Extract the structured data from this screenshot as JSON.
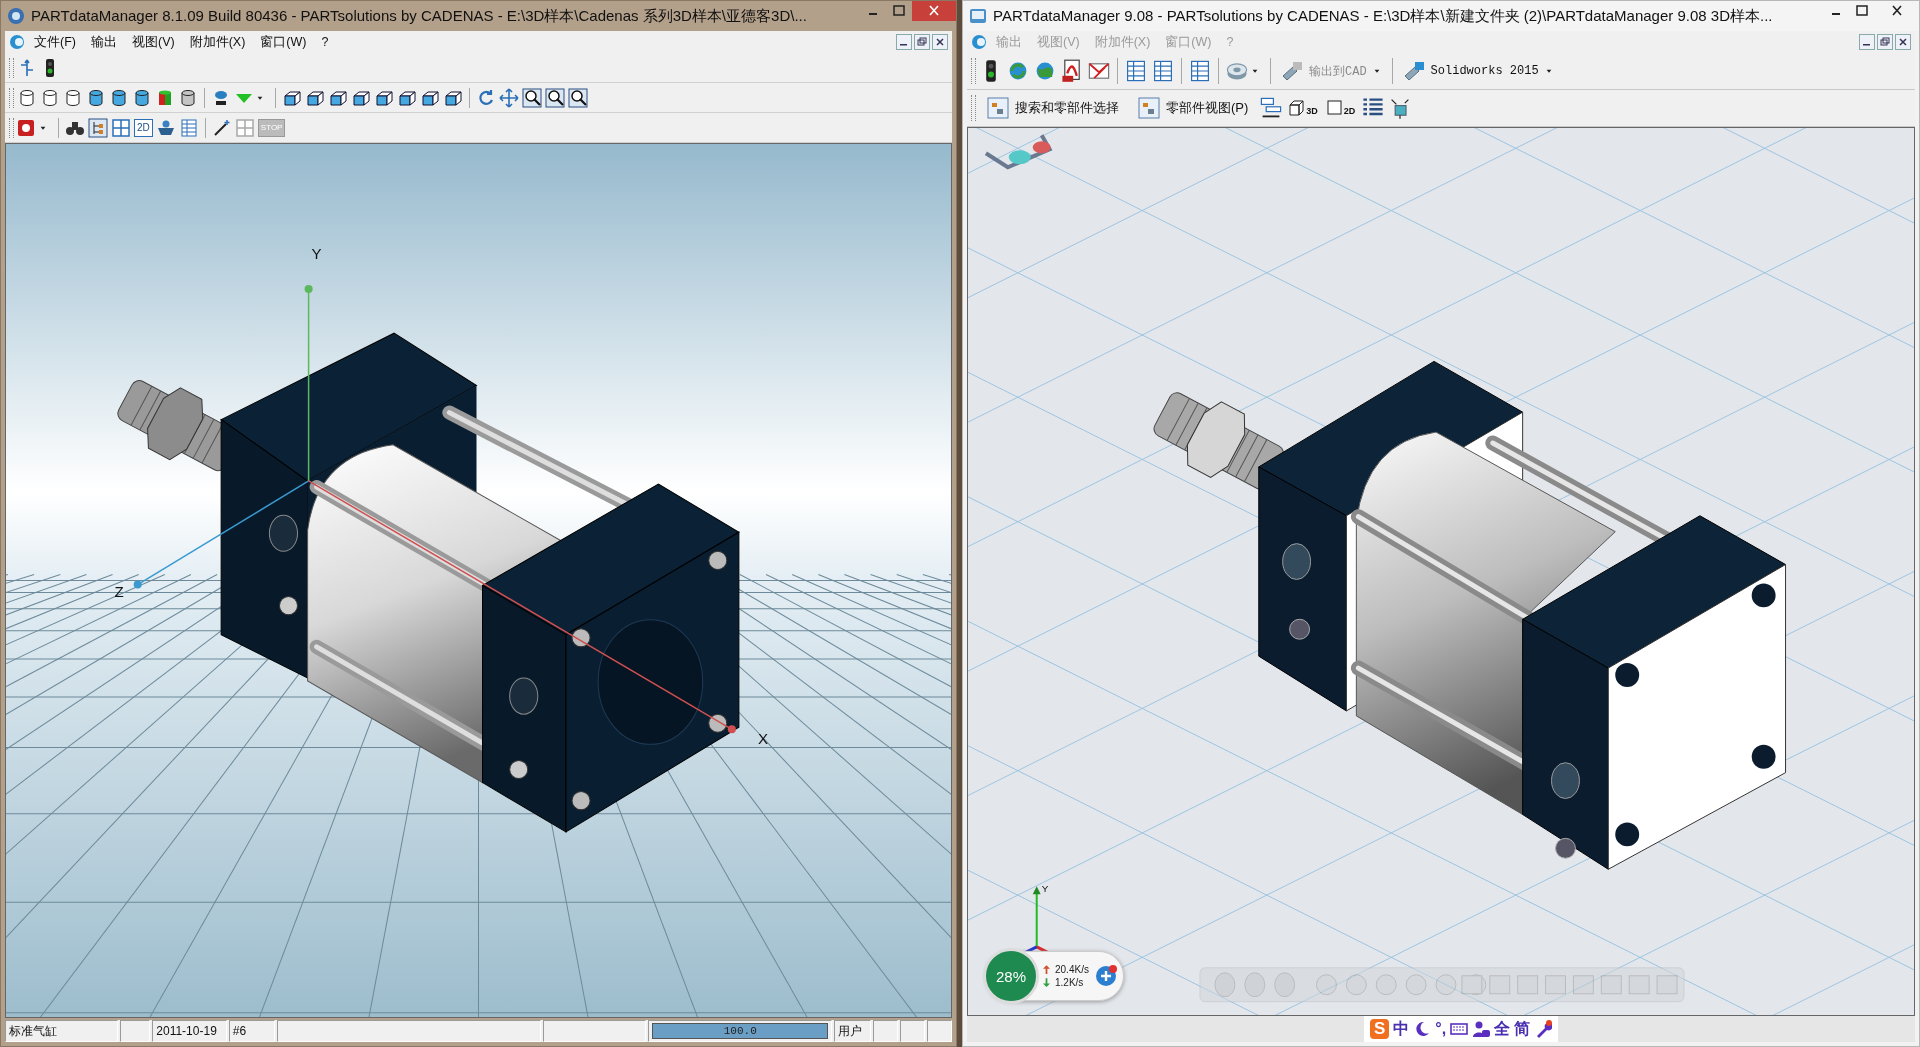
{
  "left_window": {
    "title": "PARTdataManager 8.1.09 Build 80436 - PARTsolutions by CADENAS - E:\\3D样本\\Cadenas 系列3D样本\\亚德客3D\\...",
    "active": true,
    "menu": {
      "disabled": false,
      "items": [
        {
          "label": "文件(F)"
        },
        {
          "label": "输出"
        },
        {
          "label": "视图(V)"
        },
        {
          "label": "附加件(X)"
        },
        {
          "label": "窗口(W)"
        },
        {
          "label": "?"
        }
      ]
    },
    "toolbars": [
      [
        {
          "kind": "arrows"
        },
        {
          "kind": "light"
        }
      ],
      [
        {
          "kind": "cyl-outline"
        },
        {
          "kind": "cyl-outline"
        },
        {
          "kind": "cyl-outline"
        },
        {
          "kind": "cyl-blue"
        },
        {
          "kind": "cyl-blue"
        },
        {
          "kind": "cyl-blue"
        },
        {
          "kind": "cyl-color"
        },
        {
          "kind": "cyl-grey"
        },
        {
          "kind": "lamp"
        },
        {
          "kind": "triangle"
        },
        {
          "kind": "caret"
        },
        {
          "kind": "cube"
        },
        {
          "kind": "cube"
        },
        {
          "kind": "cube"
        },
        {
          "kind": "cube"
        },
        {
          "kind": "cube"
        },
        {
          "kind": "cube"
        },
        {
          "kind": "cube"
        },
        {
          "kind": "cube"
        },
        {
          "kind": "rotate"
        },
        {
          "kind": "move"
        },
        {
          "kind": "zoom"
        },
        {
          "kind": "zoom"
        },
        {
          "kind": "zoom"
        }
      ],
      [
        {
          "kind": "logo"
        },
        {
          "kind": "caret"
        },
        {
          "kind": "binoculars"
        },
        {
          "kind": "tree"
        },
        {
          "kind": "grid"
        },
        {
          "kind": "text",
          "label": "2D"
        },
        {
          "kind": "basket"
        },
        {
          "kind": "table"
        },
        {
          "kind": "wand"
        },
        {
          "kind": "grid-grey"
        },
        {
          "kind": "stop",
          "label": "STOP"
        }
      ]
    ],
    "viewport": {
      "axes": [
        {
          "label": "Y"
        },
        {
          "label": "Z"
        },
        {
          "label": "X"
        }
      ]
    },
    "status_bar": [
      {
        "kind": "text",
        "text": "标准气缸"
      },
      {
        "kind": "blank"
      },
      {
        "kind": "text",
        "text": "2011-10-19"
      },
      {
        "kind": "text",
        "text": "#6"
      },
      {
        "kind": "blank"
      },
      {
        "kind": "blank"
      },
      {
        "kind": "progress",
        "level": 1,
        "text": "100.0"
      },
      {
        "kind": "text",
        "text": "用户"
      },
      {
        "kind": "blank"
      },
      {
        "kind": "blank"
      },
      {
        "kind": "blank"
      }
    ]
  },
  "right_window": {
    "title": "PARTdataManager 9.08 - PARTsolutions by CADENAS - E:\\3D样本\\新建文件夹 (2)\\PARTdataManager 9.08 3D样本...",
    "active": false,
    "menu": {
      "disabled": true,
      "items": [
        {
          "label": "输出"
        },
        {
          "label": "视图(V)"
        },
        {
          "label": "附加件(X)"
        },
        {
          "label": "窗口(W)"
        },
        {
          "label": "?"
        }
      ]
    },
    "toolbars": [
      [
        {
          "kind": "light"
        },
        {
          "kind": "refresh"
        },
        {
          "kind": "globe"
        },
        {
          "kind": "pdf"
        },
        {
          "kind": "mail"
        },
        {
          "kind": "table"
        },
        {
          "kind": "table"
        },
        {
          "kind": "view"
        },
        {
          "kind": "disc"
        },
        {
          "kind": "caret"
        },
        {
          "kind": "button",
          "label": "输出到CAD",
          "disabled": true
        },
        {
          "kind": "caret"
        },
        {
          "kind": "button",
          "label": "Solidworks 2015",
          "disabled": false
        },
        {
          "kind": "caret"
        }
      ],
      [
        {
          "kind": "panel",
          "label": "搜索和零部件选择"
        },
        {
          "kind": "panel",
          "label": "零部件视图(P)"
        },
        {
          "kind": "layout"
        },
        {
          "kind": "cube-text",
          "label": "3D"
        },
        {
          "kind": "square-text",
          "label": "2D"
        },
        {
          "kind": "list"
        },
        {
          "kind": "network"
        }
      ]
    ],
    "viewport": {
      "axes": [
        {
          "label": "Y"
        }
      ]
    },
    "traffic_widget": {
      "percent": "28%",
      "upload": "20.4K/s",
      "download": "1.2K/s"
    },
    "ime_bar": [
      {
        "kind": "logo",
        "text": "S"
      },
      {
        "kind": "text",
        "text": "中"
      },
      {
        "kind": "moon"
      },
      {
        "kind": "text",
        "text": "°,"
      },
      {
        "kind": "keyboard"
      },
      {
        "kind": "user"
      },
      {
        "kind": "text",
        "text": "全"
      },
      {
        "kind": "text",
        "text": "简"
      },
      {
        "kind": "wrench"
      }
    ]
  }
}
